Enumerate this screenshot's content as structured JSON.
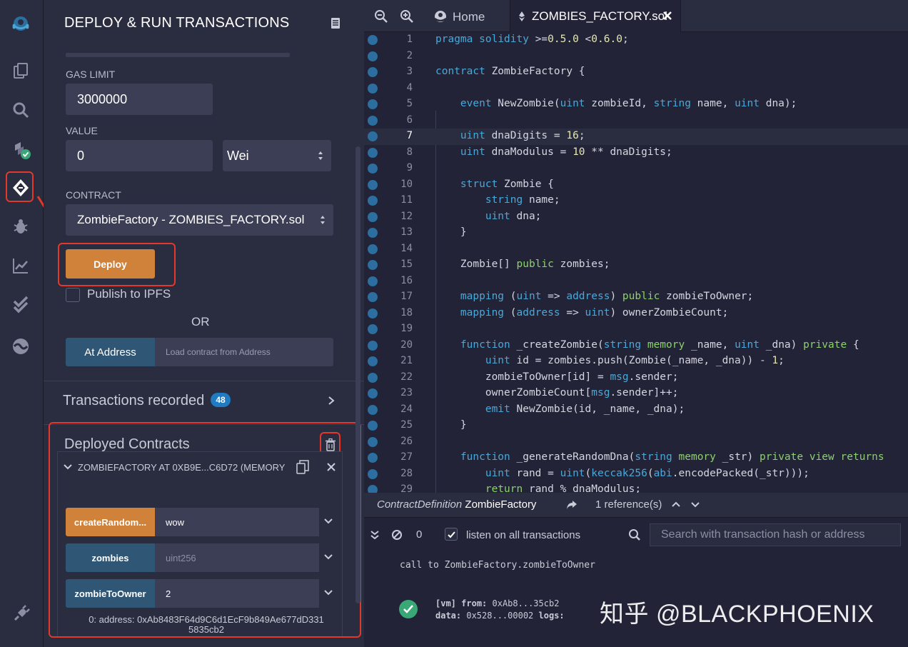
{
  "side_panel": {
    "title": "DEPLOY & RUN TRANSACTIONS",
    "gas_limit_label": "GAS LIMIT",
    "gas_limit_value": "3000000",
    "value_label": "VALUE",
    "value_amount": "0",
    "value_unit": "Wei",
    "contract_label": "CONTRACT",
    "contract_selected": "ZombieFactory - ZOMBIES_FACTORY.sol",
    "deploy_label": "Deploy",
    "publish_ipfs_label": "Publish to IPFS",
    "or_label": "OR",
    "at_address_label": "At Address",
    "at_address_placeholder": "Load contract from Address",
    "transactions_recorded_label": "Transactions recorded",
    "transactions_recorded_count": "48",
    "deployed_contracts_label": "Deployed Contracts",
    "instance_name": "ZOMBIEFACTORY AT 0XB9E...C6D72 (MEMORY)",
    "functions": [
      {
        "label": "createRandom...",
        "value": "wow",
        "placeholder": false,
        "color": "#d0823a"
      },
      {
        "label": "zombies",
        "value": "uint256",
        "placeholder": true,
        "color": "#2f5775"
      },
      {
        "label": "zombieToOwner",
        "value": "2",
        "placeholder": false,
        "color": "#2f5775"
      }
    ],
    "result_line1": "0: address: 0xAb8483F64d9C6d1EcF9b849Ae677dD331",
    "result_line2": "5835cb2"
  },
  "editor": {
    "home_tab_label": "Home",
    "file_tab_label": "ZOMBIES_FACTORY.sol",
    "current_line": 7,
    "code_lines": [
      {
        "n": "1",
        "html": "<span class='kw'>pragma</span> <span class='kw'>solidity</span> >=<span class='nu'>0.5.0</span> <<span class='nu'>0.6.0</span>;"
      },
      {
        "n": "2",
        "html": ""
      },
      {
        "n": "3",
        "html": "<span class='kw'>contract</span> ZombieFactory {"
      },
      {
        "n": "4",
        "html": ""
      },
      {
        "n": "5",
        "html": "    <span class='kw'>event</span> NewZombie(<span class='kw'>uint</span> zombieId, <span class='kw'>string</span> name, <span class='kw'>uint</span> dna);"
      },
      {
        "n": "6",
        "html": ""
      },
      {
        "n": "7",
        "html": "    <span class='kw'>uint</span> dnaDigits = <span class='nu'>16</span>;"
      },
      {
        "n": "8",
        "html": "    <span class='kw'>uint</span> dnaModulus = <span class='nu'>10</span> ** dnaDigits;"
      },
      {
        "n": "9",
        "html": ""
      },
      {
        "n": "10",
        "html": "    <span class='kw'>struct</span> Zombie {"
      },
      {
        "n": "11",
        "html": "        <span class='kw'>string</span> name;"
      },
      {
        "n": "12",
        "html": "        <span class='kw'>uint</span> dna;"
      },
      {
        "n": "13",
        "html": "    }"
      },
      {
        "n": "14",
        "html": ""
      },
      {
        "n": "15",
        "html": "    Zombie[] <span class='gr'>public</span> zombies;"
      },
      {
        "n": "16",
        "html": ""
      },
      {
        "n": "17",
        "html": "    <span class='kw'>mapping</span> (<span class='kw'>uint</span> => <span class='kw'>address</span>) <span class='gr'>public</span> zombieToOwner;"
      },
      {
        "n": "18",
        "html": "    <span class='kw'>mapping</span> (<span class='kw'>address</span> => <span class='kw'>uint</span>) ownerZombieCount;"
      },
      {
        "n": "19",
        "html": ""
      },
      {
        "n": "20",
        "html": "    <span class='kw'>function</span> _createZombie(<span class='kw'>string</span> <span class='gr'>memory</span> _name, <span class='kw'>uint</span> _dna) <span class='gr'>private</span> {"
      },
      {
        "n": "21",
        "html": "        <span class='kw'>uint</span> id = zombies.push(Zombie(_name, _dna)) - <span class='nu'>1</span>;"
      },
      {
        "n": "22",
        "html": "        zombieToOwner[id] = <span class='kw'>msg</span>.sender;"
      },
      {
        "n": "23",
        "html": "        ownerZombieCount[<span class='kw'>msg</span>.sender]++;"
      },
      {
        "n": "24",
        "html": "        <span class='kw'>emit</span> NewZombie(id, _name, _dna);"
      },
      {
        "n": "25",
        "html": "    }"
      },
      {
        "n": "26",
        "html": ""
      },
      {
        "n": "27",
        "html": "    <span class='kw'>function</span> _generateRandomDna(<span class='kw'>string</span> <span class='gr'>memory</span> _str) <span class='gr'>private</span> <span class='gr'>view</span> <span class='gr'>returns</span>"
      },
      {
        "n": "28",
        "html": "        <span class='kw'>uint</span> rand = <span class='kw'>uint</span>(<span class='kw'>keccak256</span>(<span class='kw'>abi</span>.encodePacked(_str)));"
      },
      {
        "n": "29",
        "html": "        <span class='gr'>return</span> rand % dnaModulus;"
      }
    ],
    "definition_prefix": "ContractDefinition",
    "definition_name": "ZombieFactory",
    "references_label": "1 reference(s)"
  },
  "terminal": {
    "pending_count": "0",
    "listen_label": "listen on all transactions",
    "search_placeholder": "Search with transaction hash or address",
    "call_line": "call to ZombieFactory.zombieToOwner",
    "vm_tag": "[vm]",
    "from_label": "from:",
    "from_value": "0xAb8...35cb2",
    "data_label": "data:",
    "data_value": "0x528...00002",
    "logs_label": "logs:"
  },
  "watermark": "知乎 @BLACKPHOENIX",
  "colors": {
    "accent_orange": "#d0823a",
    "accent_blue": "#2f5775",
    "annotation_red": "#e2392a",
    "badge_blue": "#1f7bc2",
    "success_green": "#3aa876"
  }
}
